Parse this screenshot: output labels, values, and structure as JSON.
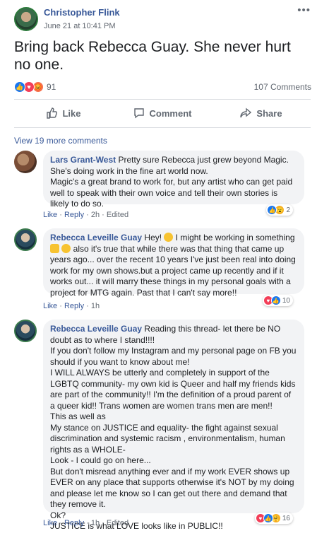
{
  "post": {
    "author": "Christopher Flink",
    "timestamp": "June 21 at 10:41 PM",
    "text": "Bring back Rebecca Guay. She never hurt no one.",
    "reaction_count": "91",
    "comment_count": "107 Comments"
  },
  "actions": {
    "like": "Like",
    "comment": "Comment",
    "share": "Share"
  },
  "view_more": "View 19 more comments",
  "comments": [
    {
      "author": "Lars Grant-West",
      "text": " Pretty sure Rebecca just grew beyond Magic. She's doing work in the fine art world now.\nMagic's a great brand to work for, but any artist who can get paid well to speak with their own voice and tell their own stories is likely to do so.",
      "like": "Like",
      "reply": "Reply",
      "time": "2h",
      "edited": "Edited",
      "reaction_count": "2"
    },
    {
      "author": "Rebecca Leveille Guay",
      "text_1": " Hey! ",
      "text_2": " I might be working in something ",
      "text_3": " also it's true that while there was that thing that came up years ago... over the recent 10 years I've just been real into doing work for my own shows.but a project came up recently and if it works out... it will marry these things in my personal goals with a project for MTG again. Past that I can't say more!!",
      "like": "Like",
      "reply": "Reply",
      "time": "1h",
      "reaction_count": "10"
    },
    {
      "author": "Rebecca Leveille Guay",
      "text": " Reading this thread- let there be NO doubt as to where I stand!!!!\nIf you don't follow my Instagram and my personal page on FB you should if you want to know about me!\nI WILL ALWAYS be utterly and completely in support of the LGBTQ community- my own kid is Queer and half my friends kids are part of the community!! I'm the definition of a proud parent of a queer kid!! Trans women are women trans men are men!!\nThis as well as\nMy stance on JUSTICE and equality- the fight against sexual discrimination and systemic racism , environmentalism, human rights as a WHOLE-\nLook - I could go on here...\nBut don't misread anything ever and if my work EVER shows up EVER on any place that supports otherwise it's NOT by my doing and please let me know so I can get out there and demand that they remove it.\nOk?\nJUSTICE is what LOVE looks like in PUBLIC!!",
      "like": "Like",
      "reply": "Reply",
      "time": "1h",
      "edited": "Edited",
      "reaction_count": "16"
    }
  ],
  "colors": {
    "link": "#385898",
    "like_blue": "#1877f2",
    "love_red": "#f33e58",
    "bubble_bg": "#f2f3f5"
  }
}
